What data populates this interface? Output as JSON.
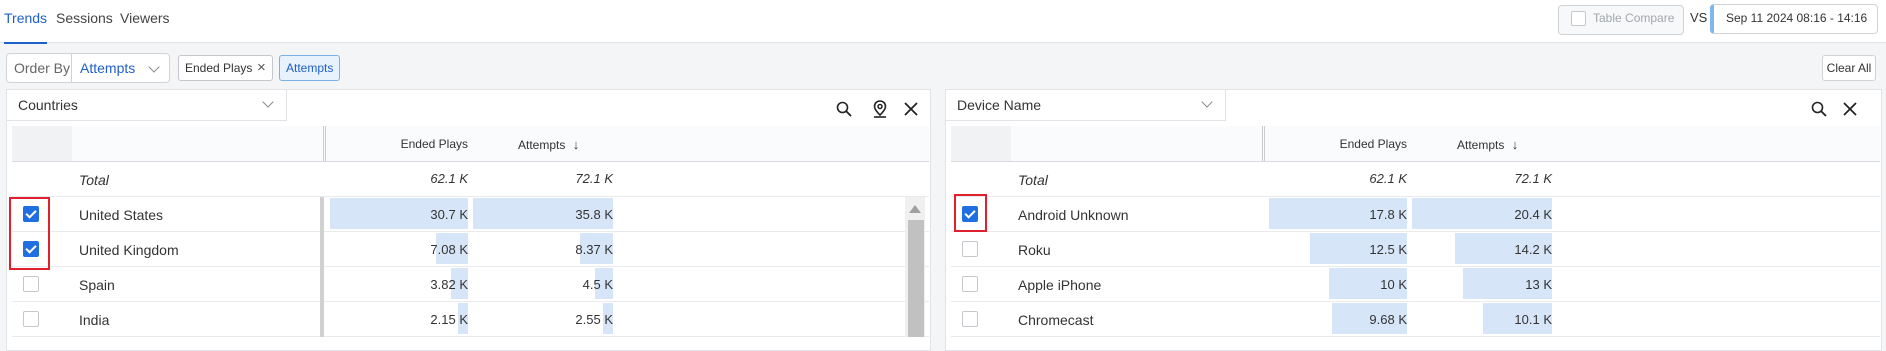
{
  "tabs": [
    {
      "label": "Trends",
      "active": true
    },
    {
      "label": "Sessions",
      "active": false
    },
    {
      "label": "Viewers",
      "active": false
    }
  ],
  "table_compare": {
    "label": "Table Compare",
    "checked": false
  },
  "vs_label": "VS",
  "date_range": "Sep 11 2024 08:16 - 14:16",
  "order_by": {
    "label": "Order By",
    "value": "Attempts"
  },
  "chips": [
    {
      "label": "Ended Plays",
      "removable": true
    },
    {
      "label": "Attempts",
      "removable": false
    }
  ],
  "clear_all": "Clear All",
  "panels": [
    {
      "title": "Countries",
      "col_ended": "Ended Plays",
      "col_attempts": "Attempts",
      "sort_arrow": "↓",
      "total": {
        "label": "Total",
        "ended": "62.1 K",
        "attempts": "72.1 K"
      },
      "rows": [
        {
          "name": "United States",
          "ended": "30.7 K",
          "attempts": "35.8 K",
          "checked": true,
          "ended_frac": 1.0,
          "attempts_frac": 1.0
        },
        {
          "name": "United Kingdom",
          "ended": "7.08 K",
          "attempts": "8.37 K",
          "checked": true,
          "ended_frac": 0.23,
          "attempts_frac": 0.234
        },
        {
          "name": "Spain",
          "ended": "3.82 K",
          "attempts": "4.5 K",
          "checked": false,
          "ended_frac": 0.124,
          "attempts_frac": 0.126
        },
        {
          "name": "India",
          "ended": "2.15 K",
          "attempts": "2.55 K",
          "checked": false,
          "ended_frac": 0.07,
          "attempts_frac": 0.071
        }
      ],
      "icons": [
        "search-icon",
        "map-pin-icon",
        "close-icon"
      ]
    },
    {
      "title": "Device Name",
      "col_ended": "Ended Plays",
      "col_attempts": "Attempts",
      "sort_arrow": "↓",
      "total": {
        "label": "Total",
        "ended": "62.1 K",
        "attempts": "72.1 K"
      },
      "rows": [
        {
          "name": "Android Unknown",
          "ended": "17.8 K",
          "attempts": "20.4 K",
          "checked": true,
          "ended_frac": 1.0,
          "attempts_frac": 1.0
        },
        {
          "name": "Roku",
          "ended": "12.5 K",
          "attempts": "14.2 K",
          "checked": false,
          "ended_frac": 0.702,
          "attempts_frac": 0.696
        },
        {
          "name": "Apple iPhone",
          "ended": "10 K",
          "attempts": "13 K",
          "checked": false,
          "ended_frac": 0.562,
          "attempts_frac": 0.637
        },
        {
          "name": "Chromecast",
          "ended": "9.68 K",
          "attempts": "10.1 K",
          "checked": false,
          "ended_frac": 0.544,
          "attempts_frac": 0.495
        }
      ],
      "icons": [
        "search-icon",
        "close-icon"
      ]
    }
  ],
  "colors": {
    "accent": "#1f5fc9",
    "bar": "#d6e6f8",
    "highlight": "#e0202c",
    "checkbox": "#1f6fe0"
  }
}
